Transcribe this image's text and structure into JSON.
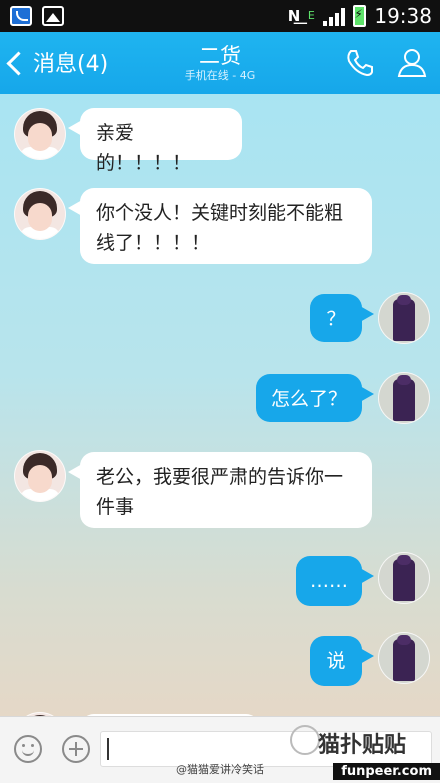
{
  "status_bar": {
    "time": "19:38",
    "network": "E"
  },
  "header": {
    "back_label": "消息(4)",
    "title": "二货",
    "subtitle": "手机在线 - 4G"
  },
  "messages": [
    {
      "side": "in",
      "text": "亲爱的！！！！"
    },
    {
      "side": "in",
      "text": "你个没人！关键时刻能不能粗线了！！！！"
    },
    {
      "side": "out",
      "text": "？"
    },
    {
      "side": "out",
      "text": "怎么了？"
    },
    {
      "side": "in",
      "text": "老公，我要很严肃的告诉你一件事"
    },
    {
      "side": "out",
      "text": "……"
    },
    {
      "side": "out",
      "text": "说"
    }
  ],
  "input": {
    "placeholder": ""
  },
  "watermark": {
    "weibo": "@猫猫爱讲冷笑话",
    "logo": "猫扑贴贴",
    "site": "funpeer.com"
  },
  "colors": {
    "accent": "#17a7ea",
    "header": "#1fb4f0"
  },
  "icons": [
    "back-chevron-icon",
    "phone-icon",
    "person-icon",
    "emoji-icon",
    "plus-icon"
  ]
}
